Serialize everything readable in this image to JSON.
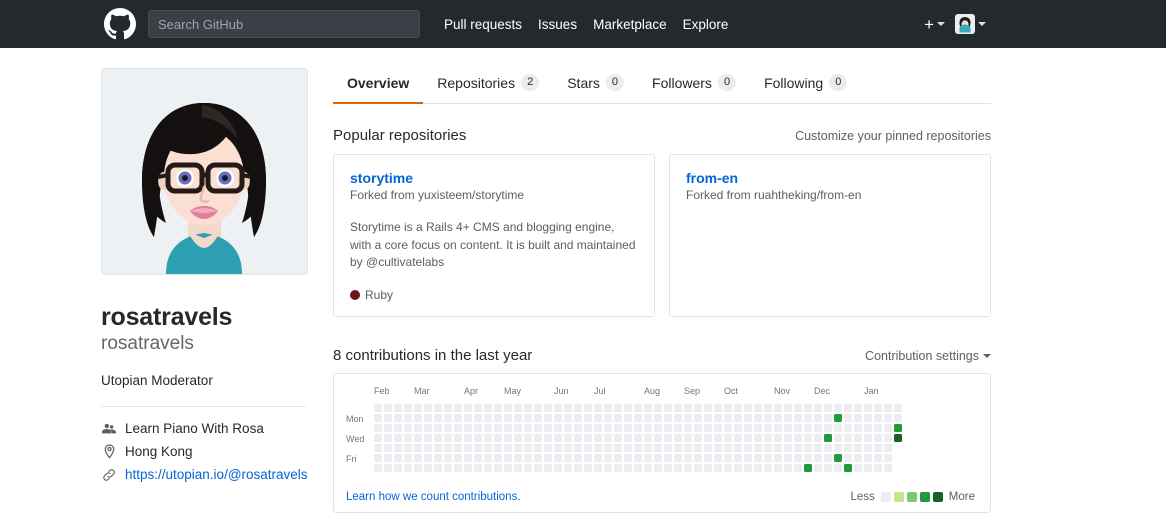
{
  "header": {
    "logo_icon": "github-mark-icon",
    "search_placeholder": "Search GitHub",
    "search_value": "",
    "nav": [
      {
        "label": "Pull requests"
      },
      {
        "label": "Issues"
      },
      {
        "label": "Marketplace"
      },
      {
        "label": "Explore"
      }
    ],
    "create_new_icon": "plus-icon",
    "create_new_label": "+",
    "profile_avatar_icon": "user-avatar-icon"
  },
  "profile": {
    "avatar_icon": "profile-avatar-illustration",
    "name": "rosatravels",
    "username": "rosatravels",
    "bio": "Utopian Moderator",
    "details": [
      {
        "icon": "organization-icon",
        "label": "Learn Piano With Rosa",
        "is_link": false
      },
      {
        "icon": "location-icon",
        "label": "Hong Kong",
        "is_link": false
      },
      {
        "icon": "link-icon",
        "label": "https://utopian.io/@rosatravels",
        "is_link": true
      }
    ]
  },
  "tabs": [
    {
      "label": "Overview",
      "count": null,
      "selected": true
    },
    {
      "label": "Repositories",
      "count": "2",
      "selected": false
    },
    {
      "label": "Stars",
      "count": "0",
      "selected": false
    },
    {
      "label": "Followers",
      "count": "0",
      "selected": false
    },
    {
      "label": "Following",
      "count": "0",
      "selected": false
    }
  ],
  "popular": {
    "title": "Popular repositories",
    "customize_link": "Customize your pinned repositories",
    "repos": [
      {
        "name": "storytime",
        "forked_prefix": "Forked from ",
        "forked_from": "yuxisteem/storytime",
        "description": "Storytime is a Rails 4+ CMS and blogging engine, with a core focus on content. It is built and maintained by @cultivatelabs",
        "language": "Ruby",
        "language_color": "#701516"
      },
      {
        "name": "from-en",
        "forked_prefix": "Forked from ",
        "forked_from": "ruahtheking/from-en",
        "description": "",
        "language": "",
        "language_color": ""
      }
    ]
  },
  "contributions": {
    "title": "8 contributions in the last year",
    "settings_label": "Contribution settings",
    "learn_link": "Learn how we count contributions.",
    "legend_less": "Less",
    "legend_more": "More",
    "legend_colors": [
      "#ebedf0",
      "#c6e48b",
      "#7bc96f",
      "#239a3b",
      "#196127"
    ],
    "day_labels": [
      "Mon",
      "Wed",
      "Fri"
    ],
    "month_labels": [
      "Feb",
      "Mar",
      "Apr",
      "May",
      "Jun",
      "Jul",
      "Aug",
      "Sep",
      "Oct",
      "Nov",
      "Dec",
      "Jan"
    ],
    "total_count": 8,
    "grid": {
      "weeks": 53,
      "days_per_week": 7,
      "empty_color": "#ebedf0",
      "active_cells": [
        {
          "week": 46,
          "day": 1,
          "level": 3
        },
        {
          "week": 45,
          "day": 3,
          "level": 3
        },
        {
          "week": 46,
          "day": 5,
          "level": 3
        },
        {
          "week": 43,
          "day": 6,
          "level": 3
        },
        {
          "week": 47,
          "day": 6,
          "level": 3
        },
        {
          "week": 52,
          "day": 2,
          "level": 3
        },
        {
          "week": 52,
          "day": 3,
          "level": 4
        }
      ]
    }
  }
}
